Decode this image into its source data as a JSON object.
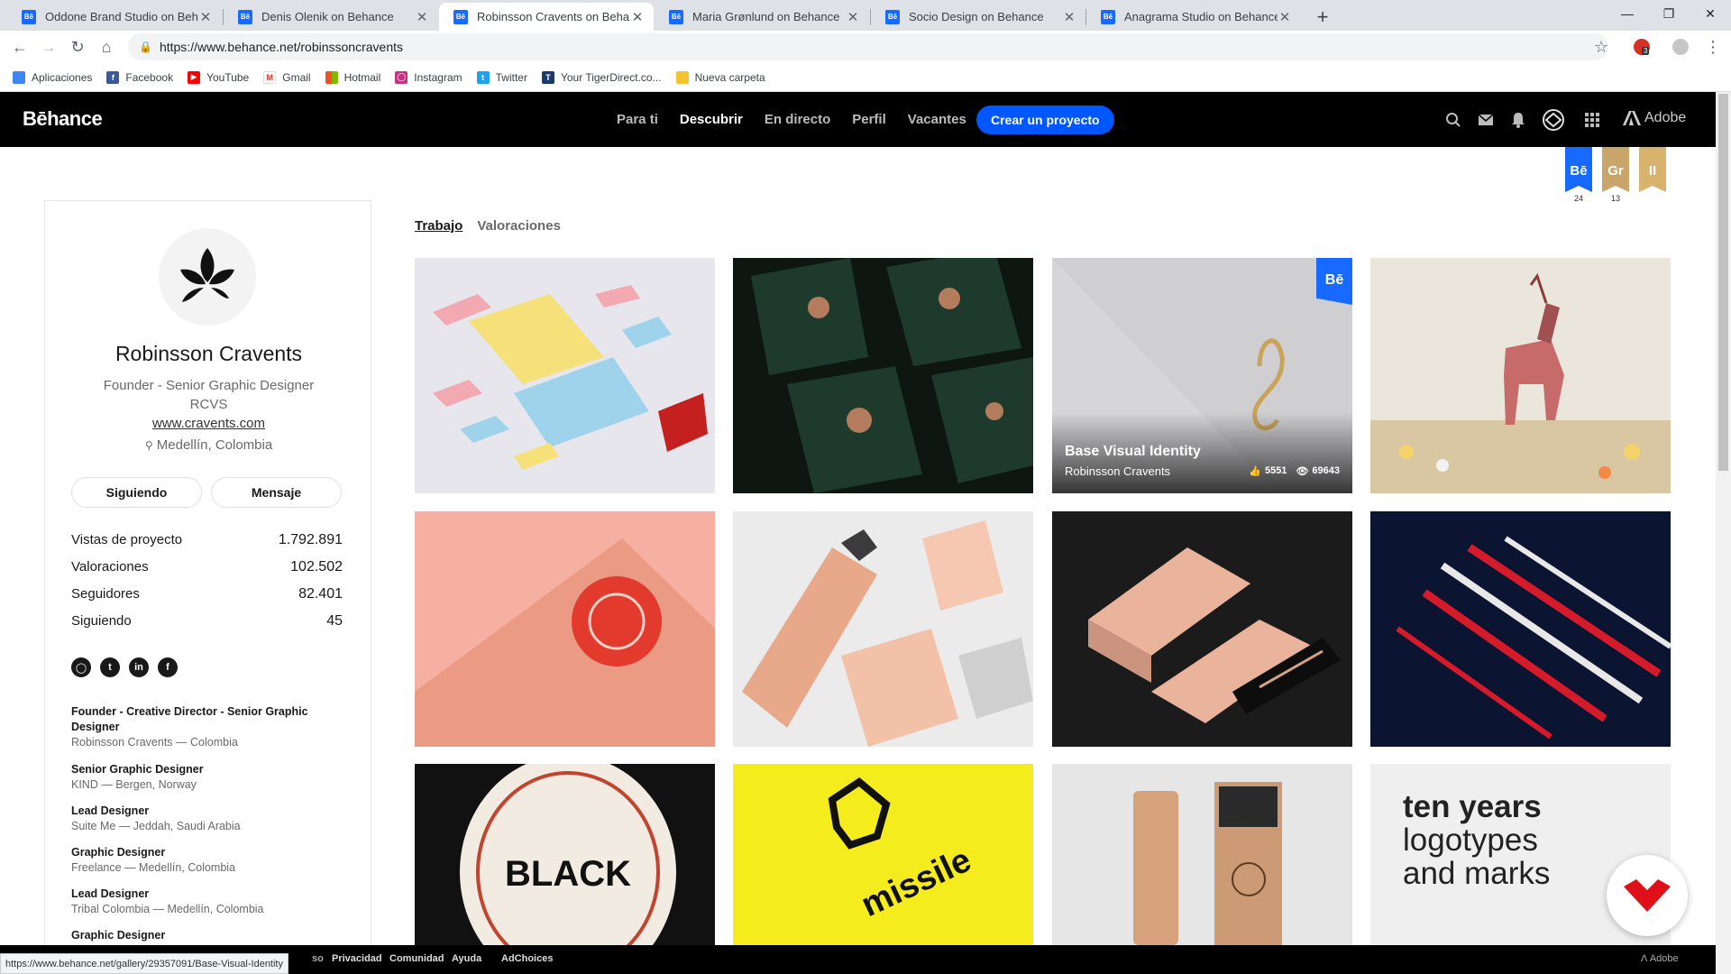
{
  "browser": {
    "tabs": [
      {
        "title": "Oddone Brand Studio on Behance"
      },
      {
        "title": "Denis Olenik on Behance"
      },
      {
        "title": "Robinsson Cravents on Behance",
        "active": true
      },
      {
        "title": "Maria Grønlund on Behance"
      },
      {
        "title": "Socio Design on Behance"
      },
      {
        "title": "Anagrama Studio on Behance"
      }
    ],
    "favicon_label": "Bē",
    "url": "https://www.behance.net/robinssoncravents",
    "bookmarks": [
      {
        "label": "Aplicaciones",
        "icon": "apps-grid-icon",
        "color": "#4285f4"
      },
      {
        "label": "Facebook",
        "icon": "facebook-icon",
        "color": "#3b5998"
      },
      {
        "label": "YouTube",
        "icon": "youtube-icon",
        "color": "#ff0000"
      },
      {
        "label": "Gmail",
        "icon": "gmail-icon",
        "color": "#d93025"
      },
      {
        "label": "Hotmail",
        "icon": "windows-icon",
        "color": "#00a4ef"
      },
      {
        "label": "Instagram",
        "icon": "instagram-icon",
        "color": "#c13584"
      },
      {
        "label": "Twitter",
        "icon": "twitter-icon",
        "color": "#1da1f2"
      },
      {
        "label": "Your TigerDirect.co...",
        "icon": "tigerdirect-icon",
        "color": "#1b3a6b"
      },
      {
        "label": "Nueva carpeta",
        "icon": "folder-icon",
        "color": "#f4c430"
      }
    ],
    "extension_badge": "3"
  },
  "behance": {
    "logo": "Bēhance",
    "nav": [
      "Para ti",
      "Descubrir",
      "En directo",
      "Perfil",
      "Vacantes"
    ],
    "create_button": "Crear un proyecto",
    "adobe_label": "Adobe",
    "accent": "#0057ff"
  },
  "badges": [
    {
      "label": "Bē",
      "count": "24",
      "color": "#1769ff"
    },
    {
      "label": "Gr",
      "count": "13",
      "color": "#c9a56b"
    },
    {
      "label": "II",
      "count": "",
      "color": "#d8b36e"
    }
  ],
  "profile": {
    "name": "Robinsson Cravents",
    "role": "Founder - Senior Graphic Designer",
    "company": "RCVS",
    "website": "www.cravents.com",
    "location": "Medellín, Colombia",
    "follow_button": "Siguiendo",
    "message_button": "Mensaje",
    "stats": [
      {
        "label": "Vistas de proyecto",
        "value": "1.792.891"
      },
      {
        "label": "Valoraciones",
        "value": "102.502"
      },
      {
        "label": "Seguidores",
        "value": "82.401"
      },
      {
        "label": "Siguiendo",
        "value": "45"
      }
    ],
    "socials": [
      "instagram-icon",
      "twitter-icon",
      "linkedin-icon",
      "facebook-icon"
    ],
    "jobs": [
      {
        "title": "Founder - Creative Director - Senior Graphic Designer",
        "company": "Robinsson Cravents — Colombia"
      },
      {
        "title": "Senior Graphic Designer",
        "company": "KIND — Bergen, Norway"
      },
      {
        "title": "Lead Designer",
        "company": "Suite Me — Jeddah, Saudi Arabia"
      },
      {
        "title": "Graphic Designer",
        "company": "Freelance — Medellín, Colombia"
      },
      {
        "title": "Lead Designer",
        "company": "Tribal Colombia — Medellín, Colombia"
      },
      {
        "title": "Graphic Designer",
        "company": ""
      }
    ]
  },
  "content": {
    "tabs": [
      "Trabajo",
      "Valoraciones"
    ],
    "featured": {
      "title": "Base Visual Identity",
      "owner": "Robinsson Cravents",
      "likes": "5551",
      "views": "69643",
      "badge": "Bē"
    },
    "promo_text": [
      "ten years",
      "logotypes",
      "and marks"
    ]
  },
  "footer": {
    "links": [
      "Privacidad",
      "Comunidad",
      "Ayuda",
      "AdChoices"
    ],
    "adobe": "Adobe",
    "status_url": "https://www.behance.net/gallery/29357091/Base-Visual-Identity",
    "truncated_prefix": "so"
  }
}
